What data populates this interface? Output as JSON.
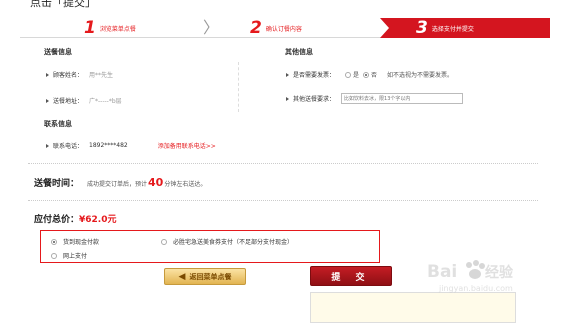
{
  "top_heading": "点击「提交」",
  "steps": [
    {
      "num": "1",
      "label": "浏览菜单点餐"
    },
    {
      "num": "2",
      "label": "确认订餐内容"
    },
    {
      "num": "3",
      "label": "选择支付并提交"
    }
  ],
  "delivery_info": {
    "title": "送餐信息",
    "customer_name_label": "顾客姓名：",
    "customer_name_value": "用**先生",
    "address_label": "送餐地址：",
    "address_value": "广*-----*b层"
  },
  "contact_info": {
    "title": "联系信息",
    "phone_label": "联系电话：",
    "phone_value": "1892****482",
    "add_phone_link": "添加备用联系电话>>"
  },
  "other_info": {
    "title": "其他信息",
    "invoice_label": "是否需要发票：",
    "invoice_yes": "是",
    "invoice_no": "否",
    "invoice_hint": "如不选视为不需要发票。",
    "requirement_label": "其他送餐要求：",
    "requirement_placeholder": "比如饮料去冰，限13个字以内"
  },
  "delivery_time": {
    "heading": "送餐时间：",
    "prefix": "成功提交订单后，预计",
    "minutes": "40",
    "suffix": "分钟左右送达。"
  },
  "total": {
    "label": "应付总价：",
    "amount": "¥62.0元"
  },
  "payment": {
    "options": [
      {
        "label": "货到现金付款",
        "selected": true
      },
      {
        "label": "必胜宅急送美食券支付（不足部分支付现金）",
        "selected": false
      },
      {
        "label": "网上支付",
        "selected": false
      }
    ]
  },
  "buttons": {
    "back_label": "返回菜单点餐",
    "submit_label": "提 交"
  },
  "watermark": {
    "brand": "Baidu经验",
    "url": "jingyan.baidu.com"
  },
  "colors": {
    "accent_red": "#e5191c",
    "step_active_bg": "#d4151f",
    "back_button": "#e2b452",
    "submit_button": "#a3161c"
  }
}
